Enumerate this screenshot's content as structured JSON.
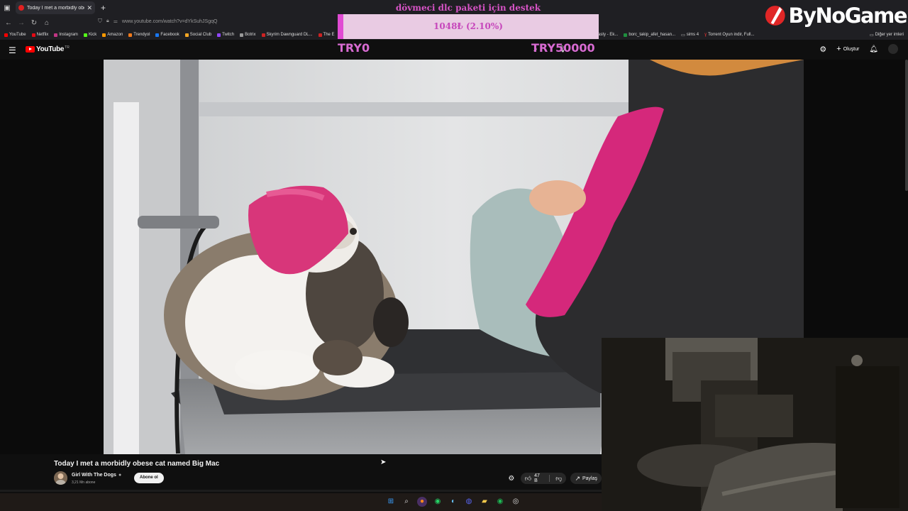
{
  "browser": {
    "tab_title": "Today I met a morbidly obese c",
    "url": "www.youtube.com/watch?v=dYkSuhJSgqQ",
    "bookmarks": [
      "YouTube",
      "Netflix",
      "Instagram",
      "Kick",
      "Amazon",
      "Trendyol",
      "Facebook",
      "Social Club",
      "Twitch",
      "Botrix",
      "Skyrim Dawnguard DL...",
      "The E"
    ],
    "bookmarks_right": [
      "asty - Ek...",
      "borc_takip_afet_hasan...",
      "sims 4",
      "Torrent Oyun indir, Full..."
    ],
    "other_bookmarks": "Diğer yer imleri",
    "bookmark_colors": [
      "#ff0000",
      "#e50914",
      "#c13584",
      "#53fc18",
      "#ff9900",
      "#f27a1a",
      "#1877f2",
      "#f5a623",
      "#9146ff",
      "#999999",
      "#cc2222",
      "#cc2222"
    ]
  },
  "youtube": {
    "logo_text": "YouTube",
    "region": "TR",
    "create_label": "Oluştur"
  },
  "donation": {
    "title": "dövmeci dlc paketi için destek",
    "amount": "1048₺ (2.10%)",
    "percent": 2.1,
    "min": "TRY0",
    "max": "TRY50000",
    "colors": {
      "text": "#d653c5",
      "bar_bg": "#e9cbe3",
      "bar_fill": "#e04bd3"
    }
  },
  "brand": {
    "text": "ByNoGame"
  },
  "video": {
    "title": "Today I met a morbidly obese cat named Big Mac",
    "channel": "Girl With The Dogs",
    "subscribers": "3,21 Mn abone",
    "subscribe_label": "Abone ol",
    "likes": "47 B",
    "share_label": "Paylaş"
  },
  "taskbar": {
    "icons": [
      "windows-start-icon",
      "search-icon",
      "firefox-icon",
      "whatsapp-icon",
      "steam-icon",
      "discord-icon",
      "file-explorer-icon",
      "spotify-icon",
      "obs-icon"
    ]
  }
}
